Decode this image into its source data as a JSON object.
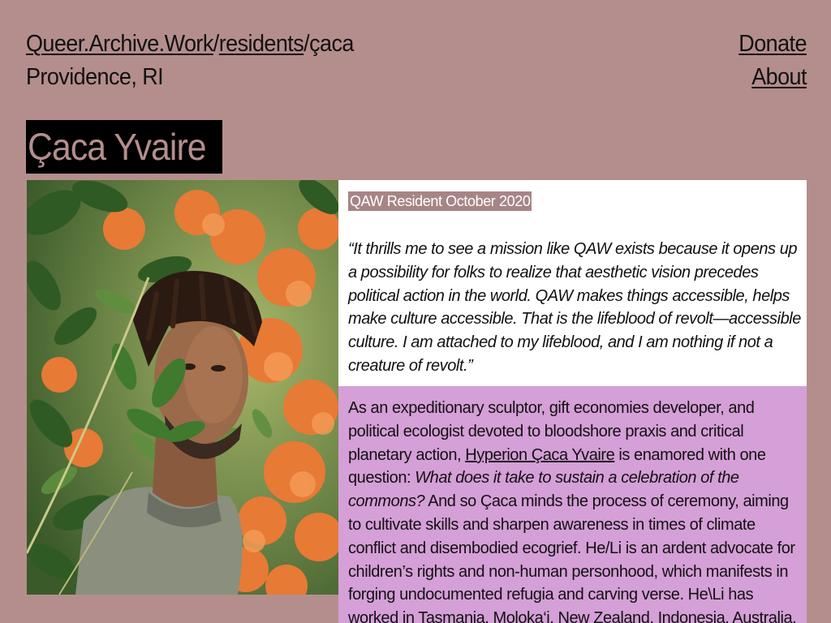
{
  "header": {
    "breadcrumb": {
      "home": "Queer.Archive.Work",
      "sep1": "/",
      "section": "residents",
      "sep2": "/",
      "current": "çaca"
    },
    "location": "Providence, RI",
    "nav": {
      "donate": "Donate",
      "about": "About"
    }
  },
  "profile": {
    "name": "Çaca Yvaire",
    "resident_badge": "QAW Resident October 2020",
    "quote": "“It thrills me to see a mission like QAW exists because it opens up a possibility for folks to realize that aesthetic vision precedes political action in the world. QAW makes things accessible, helps make culture accessible. That is the lifeblood of revolt—accessible culture. I am attached to my lifeblood, and I am nothing if not a creature of revolt.”",
    "bio": {
      "p1": "As an expeditionary sculptor, gift economies developer, and political ecologist devoted to bloodshore praxis and critical planetary action, ",
      "link_name": "Hyperion Çaca Yvaire",
      "p2": " is enamored with one question: ",
      "question": "What does it take to sustain a celebration of the commons?",
      "p3": " And so Çaca minds the process of ceremony, aiming to cultivate skills and sharpen awareness in times of climate conflict and disembodied ecogrief. He/Li is an ardent advocate for children’s rights and non-human personhood, which manifests in forging undocumented refugia and carving verse. He\\Li has worked in Tasmania, Moloka‘i, New Zealand, Indonesia, Australia,"
    }
  },
  "colors": {
    "page_bg": "#b48e8c",
    "name_bg": "#000000",
    "quote_bg": "#ffffff",
    "bio_bg": "#d59fd7",
    "badge_bg": "#a78585"
  }
}
